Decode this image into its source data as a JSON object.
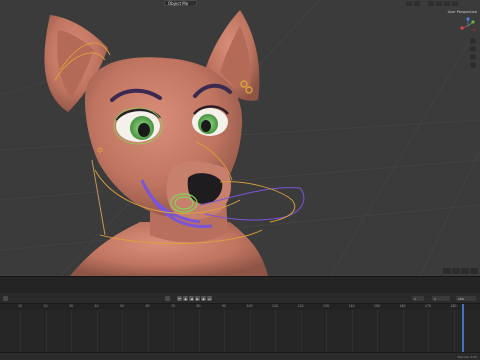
{
  "viewport": {
    "mode_label": "Object Mode",
    "view_label": "User Perspective",
    "background": "#3b3b3b",
    "grid_color": "#4a4a4a"
  },
  "timeline": {
    "start_frame": "1",
    "current_frame": "1",
    "end_frame": "250",
    "ruler_ticks": [
      "10",
      "20",
      "30",
      "40",
      "50",
      "60",
      "70",
      "80",
      "90",
      "100",
      "110",
      "120",
      "130",
      "140",
      "150",
      "160",
      "170",
      "180"
    ]
  },
  "status": {
    "version_text": "Blender 2.93"
  },
  "colors": {
    "skin": "#c87a66",
    "rig_orange": "#e0a23a",
    "rig_purple": "#7b55d8",
    "rig_green": "#7fd65a",
    "playhead": "#4772b3"
  },
  "icons": {
    "transport": [
      "jump-start-icon",
      "prev-keyframe-icon",
      "play-reverse-icon",
      "play-icon",
      "next-keyframe-icon",
      "jump-end-icon"
    ]
  }
}
